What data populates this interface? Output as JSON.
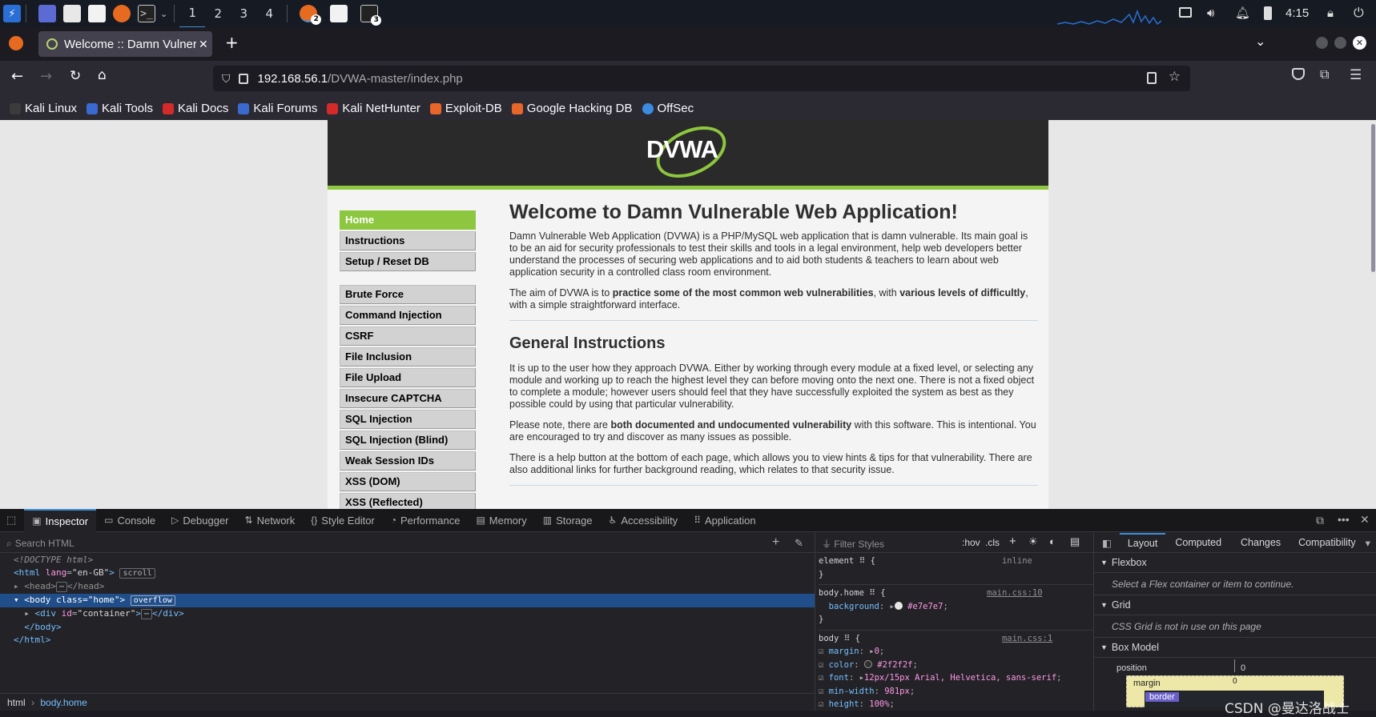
{
  "taskbar": {
    "workspaces": [
      "1",
      "2",
      "3",
      "4"
    ],
    "badges": [
      "2",
      "3"
    ],
    "clock": "4:15"
  },
  "browser": {
    "tab_title": "Welcome :: Damn Vulnera",
    "url_host": "192.168.56.1",
    "url_path": "/DVWA-master/index.php",
    "bookmarks": [
      "Kali Linux",
      "Kali Tools",
      "Kali Docs",
      "Kali Forums",
      "Kali NetHunter",
      "Exploit-DB",
      "Google Hacking DB",
      "OffSec"
    ]
  },
  "page": {
    "logo": "DVWA",
    "menu": [
      "Home",
      "Instructions",
      "Setup / Reset DB",
      "Brute Force",
      "Command Injection",
      "CSRF",
      "File Inclusion",
      "File Upload",
      "Insecure CAPTCHA",
      "SQL Injection",
      "SQL Injection (Blind)",
      "Weak Session IDs",
      "XSS (DOM)",
      "XSS (Reflected)"
    ],
    "title": "Welcome to Damn Vulnerable Web Application!",
    "p1": "Damn Vulnerable Web Application (DVWA) is a PHP/MySQL web application that is damn vulnerable. Its main goal is to be an aid for security professionals to test their skills and tools in a legal environment, help web developers better understand the processes of securing web applications and to aid both students & teachers to learn about web application security in a controlled class room environment.",
    "p2_a": "The aim of DVWA is to ",
    "p2_b": "practice some of the most common web vulnerabilities",
    "p2_c": ", with ",
    "p2_d": "various levels of difficultly",
    "p2_e": ", with a simple straightforward interface.",
    "h2": "General Instructions",
    "p3": "It is up to the user how they approach DVWA. Either by working through every module at a fixed level, or selecting any module and working up to reach the highest level they can before moving onto the next one. There is not a fixed object to complete a module; however users should feel that they have successfully exploited the system as best as they possible could by using that particular vulnerability.",
    "p4_a": "Please note, there are ",
    "p4_b": "both documented and undocumented vulnerability",
    "p4_c": " with this software. This is intentional. You are encouraged to try and discover as many issues as possible.",
    "p5": "There is a help button at the bottom of each page, which allows you to view hints & tips for that vulnerability. There are also additional links for further background reading, which relates to that security issue."
  },
  "devtools": {
    "tabs": [
      "Inspector",
      "Console",
      "Debugger",
      "Network",
      "Style Editor",
      "Performance",
      "Memory",
      "Storage",
      "Accessibility",
      "Application"
    ],
    "search_placeholder": "Search HTML",
    "filter_placeholder": "Filter Styles",
    "hov": ":hov",
    "cls": ".cls",
    "right_tabs": [
      "Layout",
      "Computed",
      "Changes",
      "Compatibility"
    ],
    "flexbox": "Flexbox",
    "flexbox_note": "Select a Flex container or item to continue.",
    "grid": "Grid",
    "grid_note": "CSS Grid is not in use on this page",
    "box_model": "Box Model",
    "position_label": "position",
    "position_val": "0",
    "margin_label": "margin",
    "border_label": "border",
    "breadcrumb_html": "html",
    "breadcrumb_body": "body.home",
    "watermark": "CSDN @曼达洛战士"
  }
}
